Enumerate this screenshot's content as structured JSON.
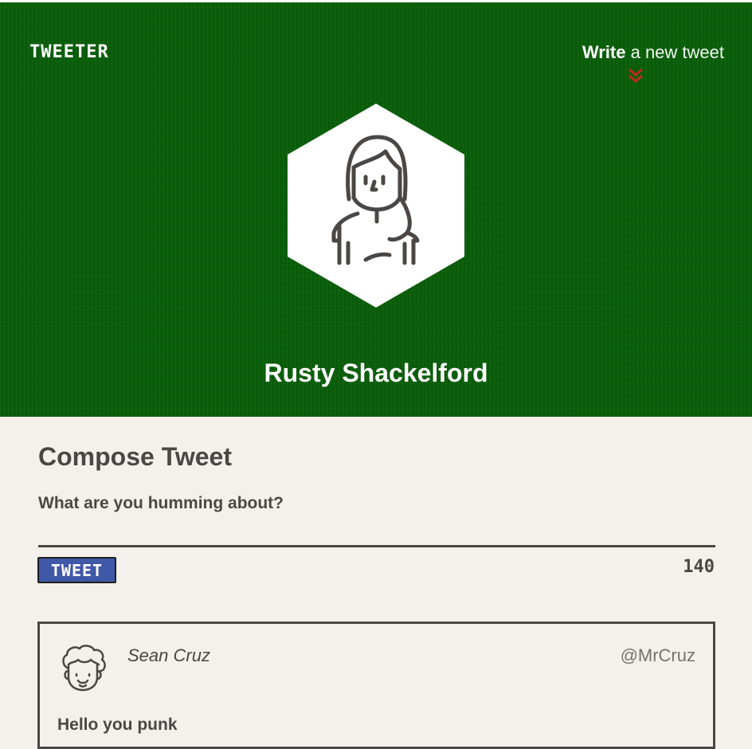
{
  "app": {
    "logo": "TWEETER"
  },
  "nav": {
    "compose_strong": "Write",
    "compose_light": "a new tweet",
    "chevron_icon": "double-chevron-down-icon",
    "chevron_color": "#c0281e"
  },
  "profile": {
    "name": "Rusty Shackelford",
    "avatar_icon": "woman-avatar-icon"
  },
  "compose": {
    "title": "Compose Tweet",
    "placeholder": "What are you humming about?",
    "value": "",
    "button_label": "TWEET",
    "char_count": "140"
  },
  "tweets": [
    {
      "author": "Sean Cruz",
      "handle": "@MrCruz",
      "text": "Hello you punk",
      "avatar_icon": "curly-haired-man-avatar-icon"
    }
  ],
  "colors": {
    "header_bg": "#0a5e0a",
    "page_bg": "#f4f1ec",
    "text": "#4a4744",
    "button_bg": "#4058a8"
  }
}
